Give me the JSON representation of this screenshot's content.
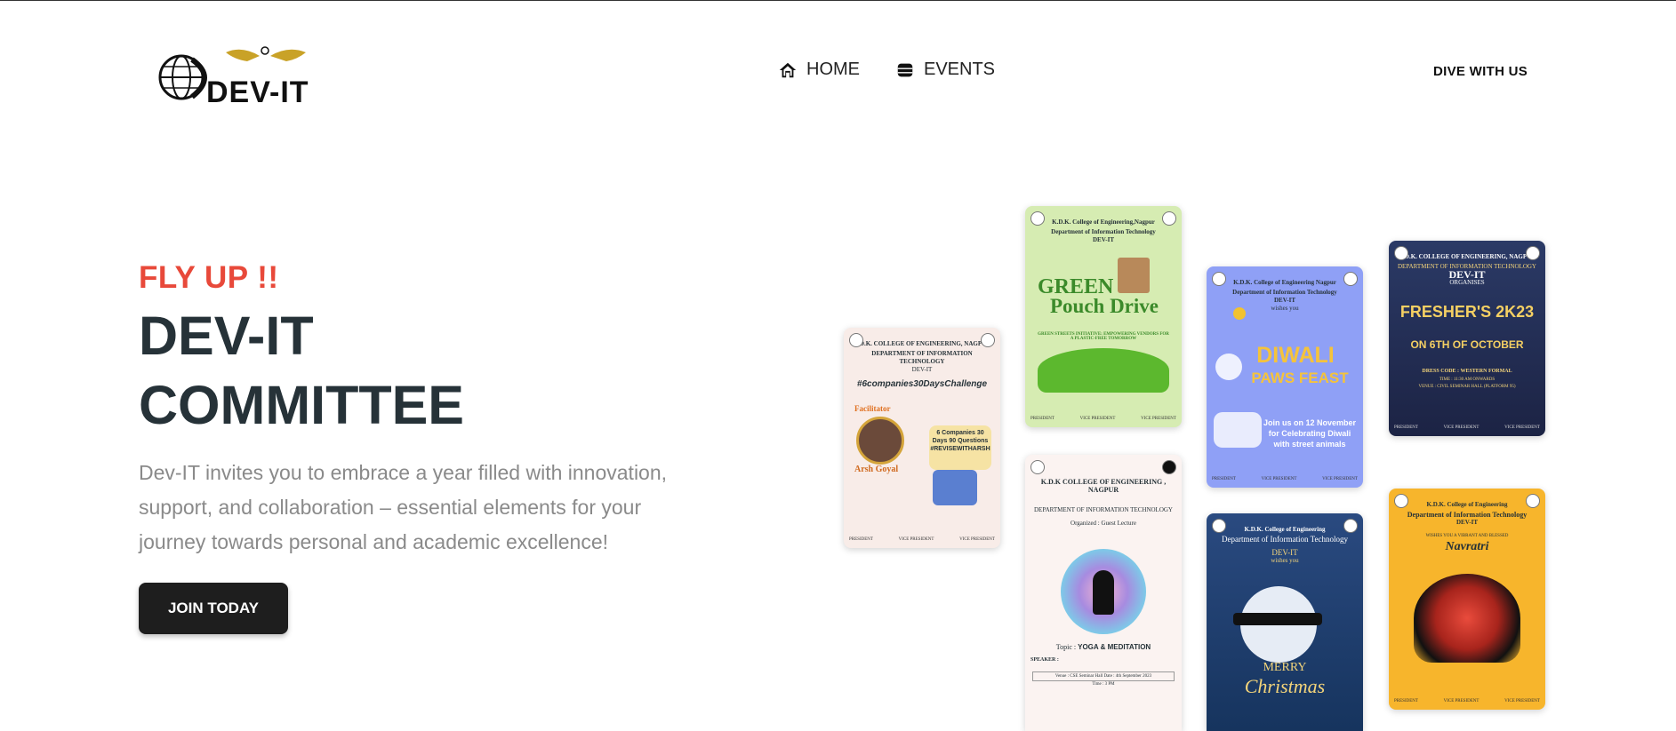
{
  "header": {
    "logo_text": "DEV-IT",
    "nav": [
      {
        "label": "HOME",
        "icon": "home-icon"
      },
      {
        "label": "EVENTS",
        "icon": "database-icon"
      }
    ],
    "cta": "DIVE WITH US"
  },
  "hero": {
    "eyebrow": "FLY UP !!",
    "title_line1": "DEV-IT",
    "title_line2": "COMMITTEE",
    "description": "Dev-IT invites you to embrace a year filled with innovation, support, and collaboration – essential elements for your journey towards personal and academic excellence!",
    "button": "JOIN TODAY"
  },
  "posters": {
    "challenge": {
      "college": "K.D.K. COLLEGE OF ENGINEERING, NAGPUR",
      "dept": "DEPARTMENT OF INFORMATION TECHNOLOGY",
      "org": "DEV-IT",
      "tag": "#6companies30DaysChallenge",
      "facilitator_label": "Facilitator",
      "facilitator": "Arsh Goyal",
      "box": "6 Companies 30 Days 90 Questions #REVISEWITHARSH"
    },
    "green": {
      "college": "K.D.K. College of Engineering,Nagpur",
      "dept": "Department of Information Technology",
      "org": "DEV-IT",
      "title1": "GREEN",
      "title2": "Pouch Drive",
      "tagline": "GREEN STREETS INITIATIVE: EMPOWERING VENDORS FOR A PLASTIC-FREE TOMORROW"
    },
    "yoga": {
      "college": "K.D.K COLLEGE OF ENGINEERING , NAGPUR",
      "dept": "DEPARTMENT OF INFORMATION TECHNOLOGY",
      "organized": "Organized : Guest Lecture",
      "topic_label": "Topic :",
      "topic": "YOGA & MEDITATION",
      "speaker_label": "SPEAKER :",
      "venue": "Venue : CSE Seminar Hall  Date : 4th September 2023",
      "time": "Time : 3 PM"
    },
    "diwali": {
      "college": "K.D.K. College of Engineering Nagpur",
      "dept": "Department of Information Technology",
      "org": "DEV-IT",
      "wish": "wishes you",
      "title1": "DIWALI",
      "title2": "PAWS FEAST",
      "note": "Join us on 12 November for Celebrating Diwali with street animals"
    },
    "christmas": {
      "college": "K.D.K. College of Engineering",
      "dept": "Department of Information Technology",
      "org": "DEV-IT",
      "wish": "wishes you",
      "title1": "MERRY",
      "title2": "Christmas"
    },
    "freshers": {
      "college": "K.D.K. COLLEGE OF ENGINEERING, NAGPUR",
      "dept": "DEPARTMENT OF INFORMATION TECHNOLOGY",
      "org": "DEV-IT",
      "organises": "ORGANISES",
      "title": "FRESHER'S 2K23",
      "date": "ON 6TH OF OCTOBER",
      "dress": "DRESS CODE : WESTERN FORMAL",
      "time": "TIME : 11:30 AM ONWARDS",
      "venue": "VENUE : CIVIL SEMINAR HALL (PLATFORM 95)"
    },
    "navratri": {
      "college": "K.D.K. College of Engineering",
      "dept": "Department of Information Technology",
      "org": "DEV-IT",
      "wish": "WISHES YOU A VIBRANT AND BLESSED",
      "title": "Navratri"
    }
  },
  "colors": {
    "eyebrow": "#e8493a",
    "title": "#263238",
    "button_bg": "#1e1e1e"
  }
}
